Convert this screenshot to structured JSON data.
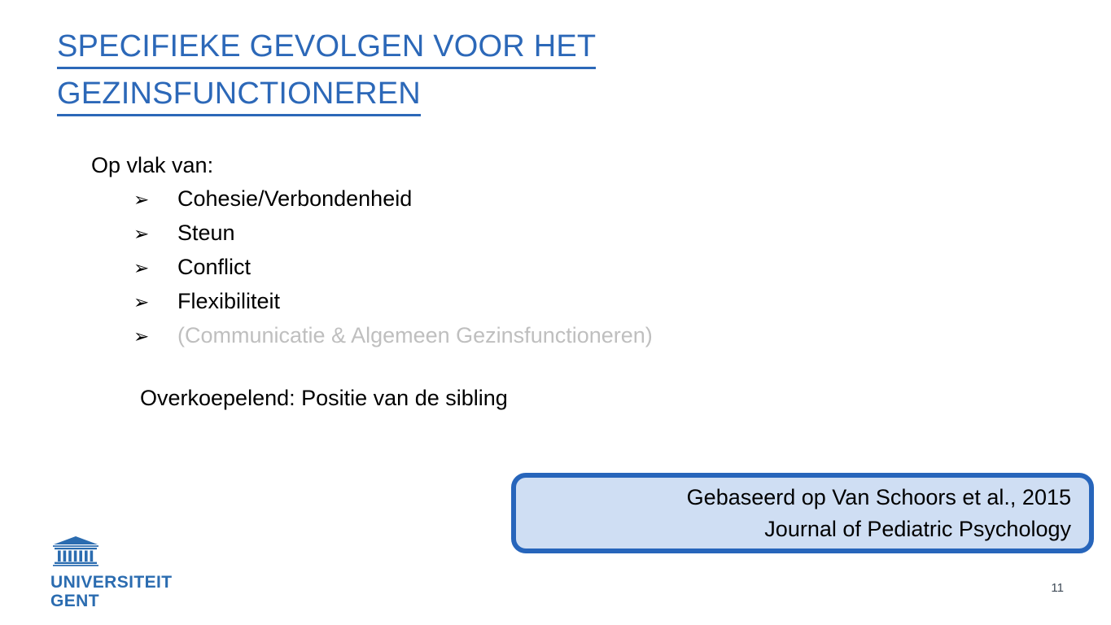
{
  "slide": {
    "title_lines": [
      "SPECIFIEKE GEVOLGEN VOOR HET",
      "GEZINSFUNCTIONEREN"
    ],
    "title_color": "#2c68b8",
    "lead": "Op vlak van:",
    "bullet_marker": "➢",
    "bullets": [
      {
        "label": "Cohesie/Verbondenheid",
        "muted": false
      },
      {
        "label": "Steun",
        "muted": false
      },
      {
        "label": "Conflict",
        "muted": false
      },
      {
        "label": "Flexibiliteit",
        "muted": false
      },
      {
        "label": "(Communicatie & Algemeen Gezinsfunctioneren)",
        "muted": true
      }
    ],
    "muted_color": "#bfbfbf",
    "overarching": "Overkoepelend: Positie van de sibling",
    "callout": {
      "lines": [
        "Gebaseerd op Van Schoors et al., 2015",
        "Journal of Pediatric Psychology"
      ],
      "fill_color": "#cfdef3",
      "border_color": "#2765bb"
    },
    "logo": {
      "icon": "university-building-icon",
      "line1": "UNIVERSITEIT",
      "line2": "GENT",
      "color": "#2b6cb0"
    },
    "page_number": "11"
  }
}
